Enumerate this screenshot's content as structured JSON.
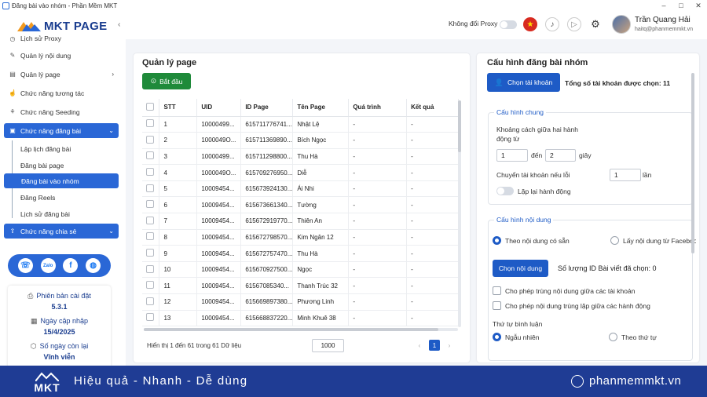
{
  "window": {
    "title": "Đăng bài vào nhóm - Phần Mềm MKT"
  },
  "brand": {
    "logo_text": "MKT PAGE",
    "accent": "#2a67d6"
  },
  "sidebar": {
    "items": [
      {
        "label": "Lịch sử Proxy",
        "icon": "history-icon"
      },
      {
        "label": "Quản lý nội dung",
        "icon": "content-icon"
      },
      {
        "label": "Quản lý page",
        "icon": "page-icon"
      },
      {
        "label": "Chức năng tương tác",
        "icon": "interact-icon"
      },
      {
        "label": "Chức năng Seeding",
        "icon": "seeding-icon"
      },
      {
        "label": "Chức năng đăng bài",
        "icon": "post-icon"
      },
      {
        "label": "Chức năng chia sẻ",
        "icon": "share-icon"
      }
    ],
    "subitems": [
      "Lập lịch đăng bài",
      "Đăng bài page",
      "Đăng bài vào nhóm",
      "Đăng Reels",
      "Lịch sử đăng bài"
    ],
    "version_label": "Phiên bản cài đặt",
    "version_value": "5.3.1",
    "update_label": "Ngày cập nhập",
    "update_value": "15/4/2025",
    "days_label": "Số ngày còn lại",
    "days_value": "Vĩnh viễn"
  },
  "header": {
    "proxy_label": "Không đổi Proxy",
    "user_name": "Trần Quang Hải",
    "user_email": "haitq@phanmemmkt.vn"
  },
  "left_panel": {
    "title": "Quản lý page",
    "start_button": "Bắt đầu",
    "columns": [
      "STT",
      "UID",
      "ID Page",
      "Tên Page",
      "Quá trình",
      "Kết quả"
    ],
    "rows": [
      [
        "1",
        "10000499...",
        "615711776741...",
        "Nhật Lệ",
        "-",
        "-"
      ],
      [
        "2",
        "1000049O...",
        "615711369890...",
        "Bích Ngọc",
        "-",
        "-"
      ],
      [
        "3",
        "10000499...",
        "615711298800...",
        "Thu Hà",
        "-",
        "-"
      ],
      [
        "4",
        "1000049O...",
        "615709276950...",
        "Diễ",
        "-",
        "-"
      ],
      [
        "5",
        "10009454...",
        "615673924130...",
        "Ái Nhi",
        "-",
        "-"
      ],
      [
        "6",
        "10009454...",
        "615673661340...",
        "Tường",
        "-",
        "-"
      ],
      [
        "7",
        "10009454...",
        "615672919770...",
        "Thiên An",
        "-",
        "-"
      ],
      [
        "8",
        "10009454...",
        "615672798570...",
        "Kim Ngân 12",
        "-",
        "-"
      ],
      [
        "9",
        "10009454...",
        "615672757470...",
        "Thu Hà",
        "-",
        "-"
      ],
      [
        "10",
        "10009454...",
        "615670927500...",
        "Ngọc",
        "-",
        "-"
      ],
      [
        "11",
        "10009454...",
        "61567085340...",
        "Thanh Trúc 32",
        "-",
        "-"
      ],
      [
        "12",
        "10009454...",
        "615669897380...",
        "Phương Linh",
        "-",
        "-"
      ],
      [
        "13",
        "10009454...",
        "615668837220...",
        "Minh Khuê 38",
        "-",
        "-"
      ]
    ],
    "footer_info": "Hiển thị 1 đến 61 trong 61 Dữ liệu",
    "page_size": "1000",
    "current_page": "1",
    "prev": "‹",
    "next": "›"
  },
  "right_panel": {
    "title": "Cấu hình đăng bài nhóm",
    "choose_account_button": "Chọn tài khoản",
    "total_accounts": "Tổng số tài khoản được chọn: 11",
    "general": {
      "title": "Cấu hình chung",
      "interval_label": "Khoảng cách giữa hai hành động từ",
      "from_value": "1",
      "to_label": "đến",
      "to_value": "2",
      "unit": "giây",
      "switch_label": "Chuyển tài khoản nếu lỗi",
      "switch_value": "1",
      "switch_unit": "lần",
      "repeat_label": "Lặp lại hành động"
    },
    "content": {
      "title": "Cấu hình nội dung",
      "opt_available": "Theo nội dung có sẵn",
      "opt_facebook": "Lấy nội dung từ Facebook",
      "choose_content_button": "Chọn nội dung",
      "selected_count": "Số lượng ID Bài viết đã chọn: 0",
      "allow_dup_accounts": "Cho phép trùng nội dung giữa các tài khoản",
      "allow_dup_actions": "Cho phép nội dung trùng lặp giữa các hành động",
      "comment_order_label": "Thứ tự bình luận",
      "random": "Ngẫu nhiên",
      "in_order": "Theo thứ tự"
    }
  },
  "banner": {
    "logo_text": "MKT",
    "slogan": "Hiệu quả - Nhanh - Dễ dùng",
    "website": "phanmemmkt.vn"
  }
}
